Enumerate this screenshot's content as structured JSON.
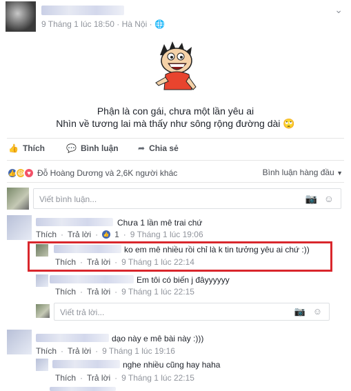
{
  "post": {
    "author_name": "",
    "meta_time": "9 Tháng 1 lúc 18:50",
    "meta_location": "Hà Nội",
    "line1": "Phận là con gái, chưa một lần yêu ai",
    "line2": "Nhìn về tương lai mà thấy như sông rộng đường dài",
    "line2_emoji": "🙄"
  },
  "actions": {
    "like": "Thích",
    "comment": "Bình luận",
    "share": "Chia sẻ"
  },
  "reactions": {
    "summary": "Đỗ Hoàng Dương và 2,6K người khác",
    "sort": "Bình luận hàng đầu"
  },
  "composer": {
    "placeholder": "Viết bình luận..."
  },
  "comments": [
    {
      "text": "Chưa 1 lần mê trai chứ",
      "like": "Thích",
      "reply": "Trả lời",
      "likes": "1",
      "time": "9 Tháng 1 lúc 19:06"
    },
    {
      "text": "ko em mê nhiều rồi chỉ là k tin tưởng yêu ai chứ :))",
      "like": "Thích",
      "reply": "Trả lời",
      "time": "9 Tháng 1 lúc 22:14"
    },
    {
      "text": "Em tôi có biến j đâyyyyyy",
      "like": "Thích",
      "reply": "Trả lời",
      "time": "9 Tháng 1 lúc 22:15"
    },
    {
      "text": "dạo này e mê bài này :)))",
      "like": "Thích",
      "reply": "Trả lời",
      "time": "9 Tháng 1 lúc 19:16"
    },
    {
      "text": "nghe nhiều cũng hay haha",
      "like": "Thích",
      "reply": "Trả lời",
      "time": "9 Tháng 1 lúc 22:15"
    }
  ],
  "reply_composer": {
    "placeholder": "Viết trả lời..."
  },
  "colors": {
    "accent": "#4267b2",
    "highlight": "#d9262c",
    "divider": "#e5e5e5"
  }
}
